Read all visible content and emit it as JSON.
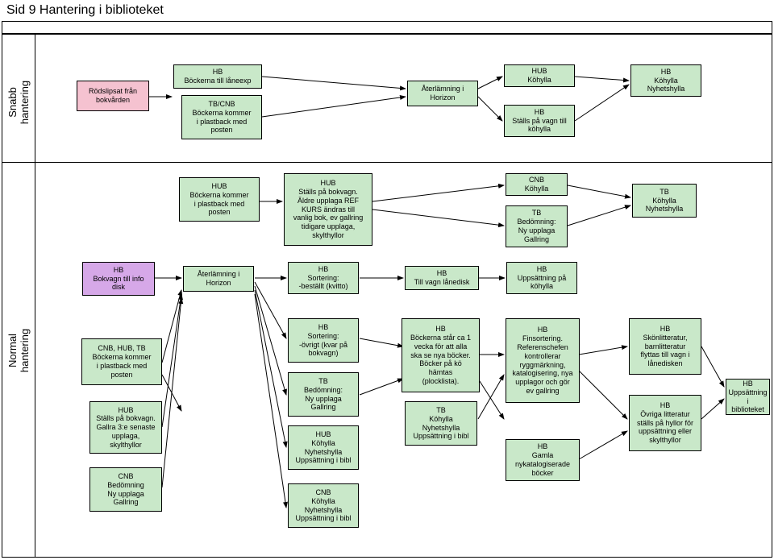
{
  "title": "Sid 9 Hantering i biblioteket",
  "lanes": {
    "snabb": "Snabb\nhantering",
    "normal": "Normal\nhantering"
  },
  "nodes": {
    "n1": "Rödslipsat från\nbokvården",
    "n2": "HB\nBöckerna till låneexp",
    "n3": "TB/CNB\nBöckerna kommer\ni plastback med\nposten",
    "n4": "Återlämning i\nHorizon",
    "n5": "HUB\nKöhylla",
    "n6": "HB\nStälls på vagn till\nköhylla",
    "n7": "HB\nKöhylla\nNyhetshylla",
    "n8": "HUB\nBöckerna kommer\ni plastback med\nposten",
    "n9": "HUB\nStälls på bokvagn.\nÄldre upplaga REF\nKURS ändras till\nvanlig bok, ev gallring\ntidigare upplaga,\nskylthyllor",
    "n10": "CNB\nKöhylla",
    "n11": "TB\nBedömning:\nNy upplaga\nGallring",
    "n12": "TB\nKöhylla\nNyhetshylla",
    "n13": "HB\nBokvagn till info\ndisk",
    "n14": "Återlämning i\nHorizon",
    "n15": "HB\nSortering:\n-beställt (kvitto)",
    "n16": "HB\nTill vagn lånedisk",
    "n17": "HB\nUppsättning på\nköhylla",
    "n18": "CNB, HUB, TB\nBöckerna kommer\ni plastback med\nposten",
    "n19": "HUB\nStälls på bokvagn.\nGallra 3:e senaste\nupplaga,\nskylthyllor",
    "n20": "CNB\nBedömning\nNy upplaga\nGallring",
    "n21": "HB\nSortering:\n-övrigt (kvar på\nbokvagn)",
    "n22": "TB\nBedömning:\nNy upplaga\nGallring",
    "n23": "HUB\nKöhylla\nNyhetshylla\nUppsättning i bibl",
    "n24": "CNB\nKöhylla\nNyhetshylla\nUppsättning i bibl",
    "n25": "HB\nBöckerna står ca 1\nvecka för att alla\nska se nya böcker.\nBöcker på kö\nhämtas\n(plocklista).",
    "n26": "TB\nKöhylla\nNyhetshylla\nUppsättning i bibl",
    "n27": "HB\nFinsortering.\nReferenschefen\nkontrollerar\nryggmärkning,\nkatalogisering, nya\nupplagor och gör\nev gallring",
    "n28": "HB\nGamla\nnykatalogiserade\nböcker",
    "n29": "HB\nSkönlitteratur,\nbarnlitteratur\nflyttas till vagn i\nlånedisken",
    "n30": "HB\nÖvriga litteratur\nställs på hyllor för\nuppsättning eller\nskylthyllor",
    "n31": "HB\nUppsättning i\nbiblioteket"
  }
}
